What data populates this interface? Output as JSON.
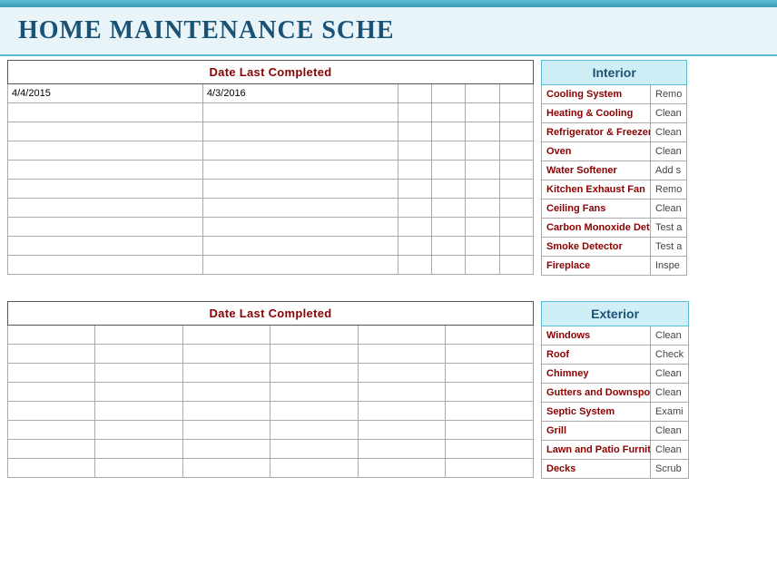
{
  "header": {
    "title": "Home Maintenance Sche",
    "top_bar_color": "#5bbcd4"
  },
  "interior_section": {
    "date_header": "Date Last Completed",
    "section_title": "Interior",
    "dates_row1": [
      "4/4/2015",
      "4/3/2016",
      "",
      "",
      "",
      ""
    ],
    "date_columns": 6,
    "empty_rows": 9,
    "tasks": [
      {
        "name": "Cooling System",
        "action": "Remo"
      },
      {
        "name": "Heating & Cooling",
        "action": "Clean"
      },
      {
        "name": "Refrigerator & Freezer",
        "action": "Clean"
      },
      {
        "name": "Oven",
        "action": "Clean"
      },
      {
        "name": "Water Softener",
        "action": "Add s"
      },
      {
        "name": "Kitchen Exhaust Fan",
        "action": "Remo"
      },
      {
        "name": "Ceiling Fans",
        "action": "Clean"
      },
      {
        "name": "Carbon Monoxide Detector",
        "action": "Test a"
      },
      {
        "name": "Smoke Detector",
        "action": "Test a"
      },
      {
        "name": "Fireplace",
        "action": "Inspe"
      }
    ]
  },
  "exterior_section": {
    "date_header": "Date Last Completed",
    "section_title": "Exterior",
    "date_columns": 6,
    "empty_rows": 9,
    "tasks": [
      {
        "name": "Windows",
        "action": "Clean"
      },
      {
        "name": "Roof",
        "action": "Check"
      },
      {
        "name": "Chimney",
        "action": "Clean"
      },
      {
        "name": "Gutters and Downspouts",
        "action": "Clean"
      },
      {
        "name": "Septic System",
        "action": "Exami"
      },
      {
        "name": "Grill",
        "action": "Clean"
      },
      {
        "name": "Lawn and Patio Furniture",
        "action": "Clean"
      },
      {
        "name": "Decks",
        "action": "Scrub"
      }
    ]
  }
}
